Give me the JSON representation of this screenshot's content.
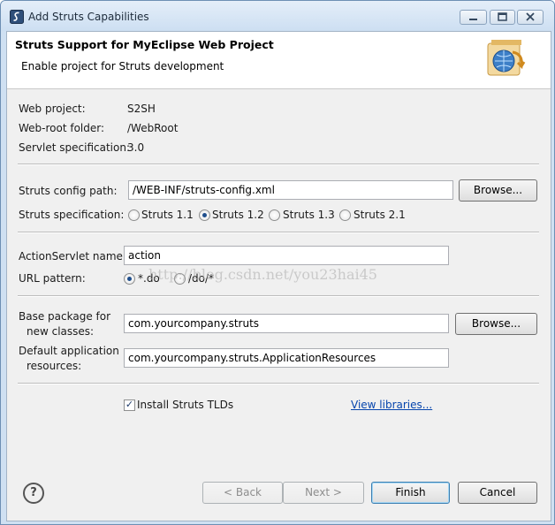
{
  "window": {
    "title": "Add Struts Capabilities",
    "icon": "myeclipse-logo-icon",
    "controls": {
      "minimize": "minimize-icon",
      "maximize": "maximize-icon",
      "close": "close-icon"
    }
  },
  "banner": {
    "title": "Struts Support for MyEclipse Web Project",
    "subtitle": "Enable project for Struts development",
    "art": "struts-wizard-banner-icon"
  },
  "project": {
    "web_project_label": "Web project:",
    "web_project_value": "S2SH",
    "web_root_label": "Web-root folder:",
    "web_root_value": "/WebRoot",
    "servlet_label": "Servlet specification:",
    "servlet_value": "3.0"
  },
  "struts": {
    "config_path_label": "Struts config path:",
    "config_path_value": "/WEB-INF/struts-config.xml",
    "browse_label": "Browse...",
    "spec_label": "Struts specification:",
    "specs": [
      {
        "label": "Struts 1.1",
        "selected": false
      },
      {
        "label": "Struts 1.2",
        "selected": true
      },
      {
        "label": "Struts 1.3",
        "selected": false
      },
      {
        "label": "Struts 2.1",
        "selected": false
      }
    ]
  },
  "servlet": {
    "action_name_label": "ActionServlet name:",
    "action_name_value": "action",
    "url_pattern_label": "URL pattern:",
    "patterns": [
      {
        "label": "*.do",
        "selected": true
      },
      {
        "label": "/do/*",
        "selected": false
      }
    ]
  },
  "package": {
    "base_label_1": "Base package for",
    "base_label_2": "new classes:",
    "base_value": "com.yourcompany.struts",
    "browse_label": "Browse...",
    "resources_label_1": "Default application",
    "resources_label_2": "resources:",
    "resources_value": "com.yourcompany.struts.ApplicationResources"
  },
  "tlds": {
    "checkbox_label": "Install Struts TLDs",
    "checked": true,
    "view_libraries": "View libraries..."
  },
  "watermark": "http://blog.csdn.net/you23hai45",
  "footer": {
    "help_icon": "help-icon",
    "back": "< Back",
    "next": "Next >",
    "finish": "Finish",
    "cancel": "Cancel"
  },
  "colors": {
    "titlebar": "#cddff2",
    "dialog_bg": "#f0f0f0",
    "link": "#0645ad",
    "radio_dot": "#1f4e8c"
  }
}
